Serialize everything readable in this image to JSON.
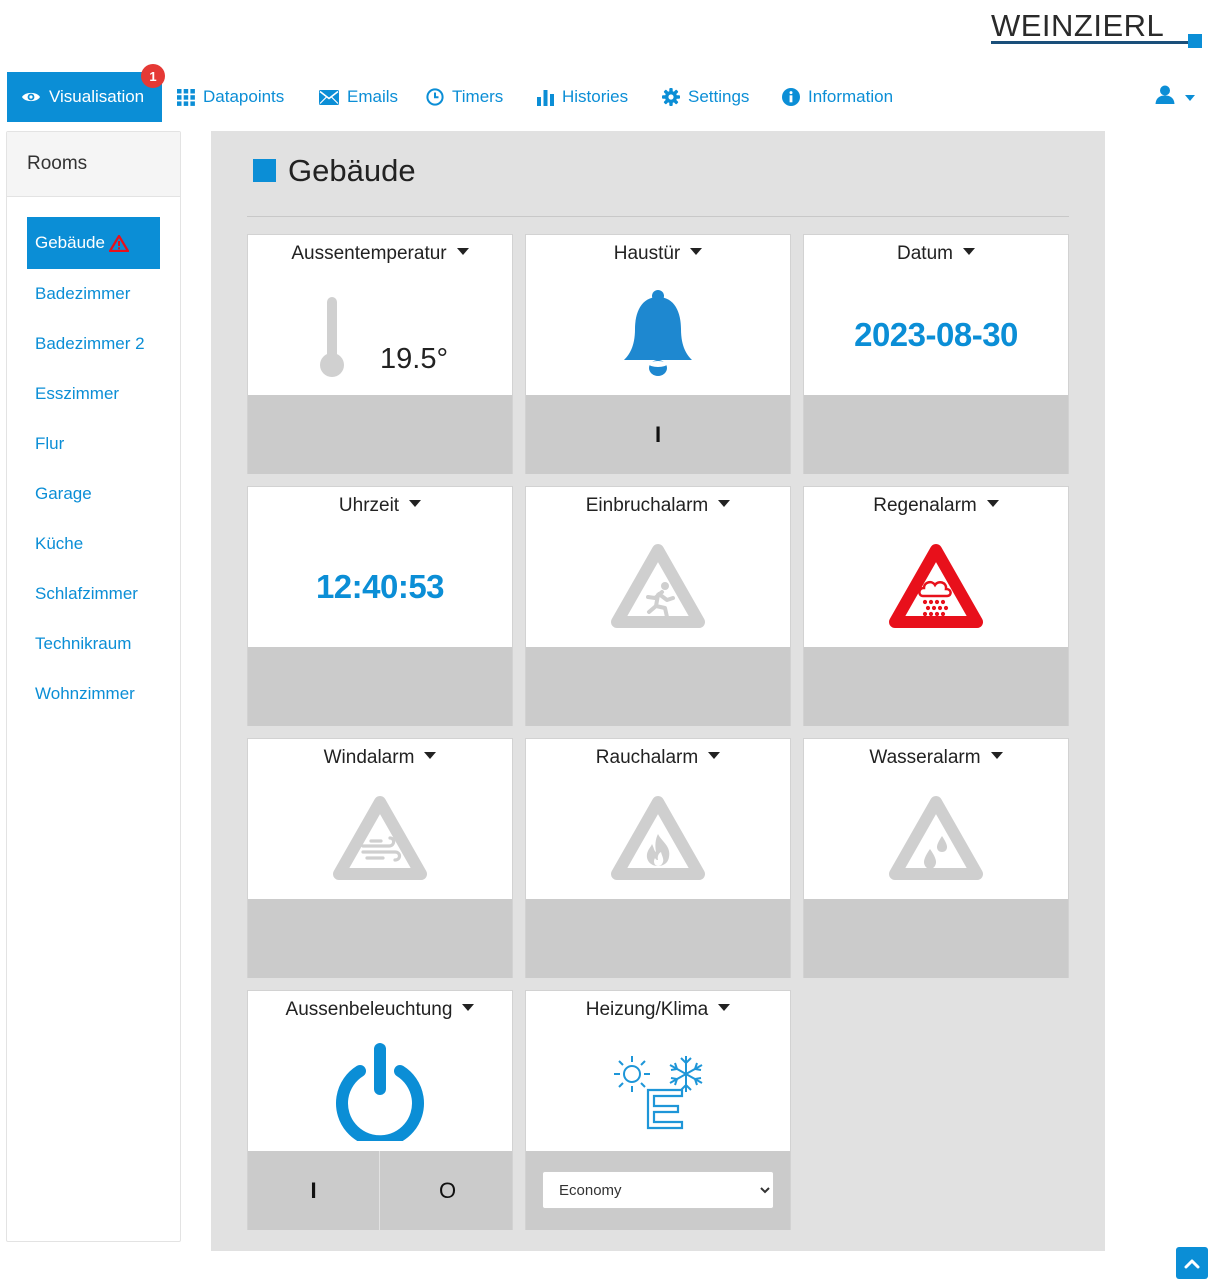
{
  "brand": {
    "logo_text": "WEINZIERL"
  },
  "nav": {
    "items": [
      {
        "label": "Visualisation",
        "icon": "eye-icon",
        "badge": "1",
        "active": true
      },
      {
        "label": "Datapoints",
        "icon": "grid-icon"
      },
      {
        "label": "Emails",
        "icon": "envelope-icon"
      },
      {
        "label": "Timers",
        "icon": "clock-icon"
      },
      {
        "label": "Histories",
        "icon": "bar-chart-icon"
      },
      {
        "label": "Settings",
        "icon": "gear-icon"
      },
      {
        "label": "Information",
        "icon": "info-icon"
      }
    ],
    "user_icon": "user-icon"
  },
  "sidebar": {
    "header": "Rooms",
    "rooms": [
      {
        "label": "Gebäude",
        "active": true,
        "alert_icon": "warning-icon"
      },
      {
        "label": "Badezimmer"
      },
      {
        "label": "Badezimmer 2"
      },
      {
        "label": "Esszimmer"
      },
      {
        "label": "Flur"
      },
      {
        "label": "Garage"
      },
      {
        "label": "Küche"
      },
      {
        "label": "Schlafzimmer"
      },
      {
        "label": "Technikraum"
      },
      {
        "label": "Wohnzimmer"
      }
    ]
  },
  "main": {
    "title": "Gebäude",
    "tiles": [
      {
        "name": "Aussentemperatur",
        "icon": "thermometer-icon",
        "value": "19.5°"
      },
      {
        "name": "Haustür",
        "icon": "bell-icon",
        "footer": "I"
      },
      {
        "name": "Datum",
        "value": "2023-08-30"
      },
      {
        "name": "Uhrzeit",
        "value": "12:40:53"
      },
      {
        "name": "Einbruchalarm",
        "icon": "intrusion-alarm-icon",
        "state": "inactive"
      },
      {
        "name": "Regenalarm",
        "icon": "rain-alarm-icon",
        "state": "active"
      },
      {
        "name": "Windalarm",
        "icon": "wind-alarm-icon",
        "state": "inactive"
      },
      {
        "name": "Rauchalarm",
        "icon": "smoke-alarm-icon",
        "state": "inactive"
      },
      {
        "name": "Wasseralarm",
        "icon": "water-alarm-icon",
        "state": "inactive"
      },
      {
        "name": "Aussenbeleuchtung",
        "icon": "power-icon",
        "on_label": "I",
        "off_label": "O"
      },
      {
        "name": "Heizung/Klima",
        "icon": "economy-mode-icon",
        "mode": "Economy"
      }
    ]
  },
  "colors": {
    "accent": "#0b8ed6",
    "alarm_active": "#e8101b",
    "alarm_inactive": "#cfcfcf",
    "badge": "#e53935"
  }
}
